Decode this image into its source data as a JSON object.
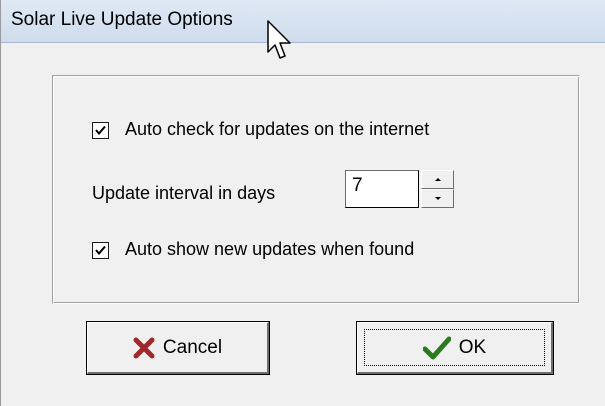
{
  "window": {
    "title": "Solar Live Update Options"
  },
  "options": {
    "auto_check": {
      "label": "Auto check for updates on the internet",
      "checked": true
    },
    "interval": {
      "label": "Update interval in days",
      "value": "7"
    },
    "auto_show": {
      "label": "Auto show new updates when found",
      "checked": true
    }
  },
  "buttons": {
    "cancel": {
      "label": "Cancel",
      "icon": "x-icon",
      "color": "#a0282b"
    },
    "ok": {
      "label": "OK",
      "icon": "checkmark-icon",
      "color": "#2b7a1f"
    }
  }
}
